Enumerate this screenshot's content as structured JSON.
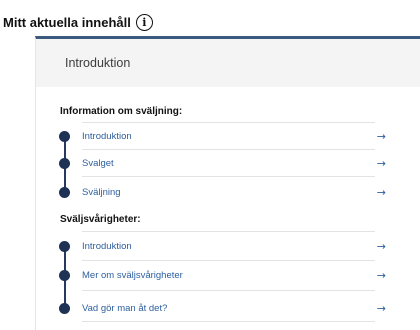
{
  "header": {
    "title": "Mitt aktuella innehåll",
    "info_icon": "i"
  },
  "card": {
    "title": "Introduktion",
    "accent_color": "#3c5a7e",
    "head_bg": "#f4f4f4"
  },
  "sections": [
    {
      "title": "Information om sväljning:",
      "items": [
        {
          "label": "Introduktion",
          "arrow": "→"
        },
        {
          "label": "Svalget",
          "arrow": "→"
        },
        {
          "label": "Sväljning",
          "arrow": "→"
        }
      ]
    },
    {
      "title": "Sväljsvårigheter:",
      "items": [
        {
          "label": "Introduktion",
          "arrow": "→"
        },
        {
          "label": "Mer om sväljsvårigheter",
          "arrow": "→"
        },
        {
          "label": "Vad gör man åt det?",
          "arrow": "→"
        }
      ]
    }
  ],
  "colors": {
    "link": "#2d5f9e",
    "timeline": "#1d3254"
  }
}
